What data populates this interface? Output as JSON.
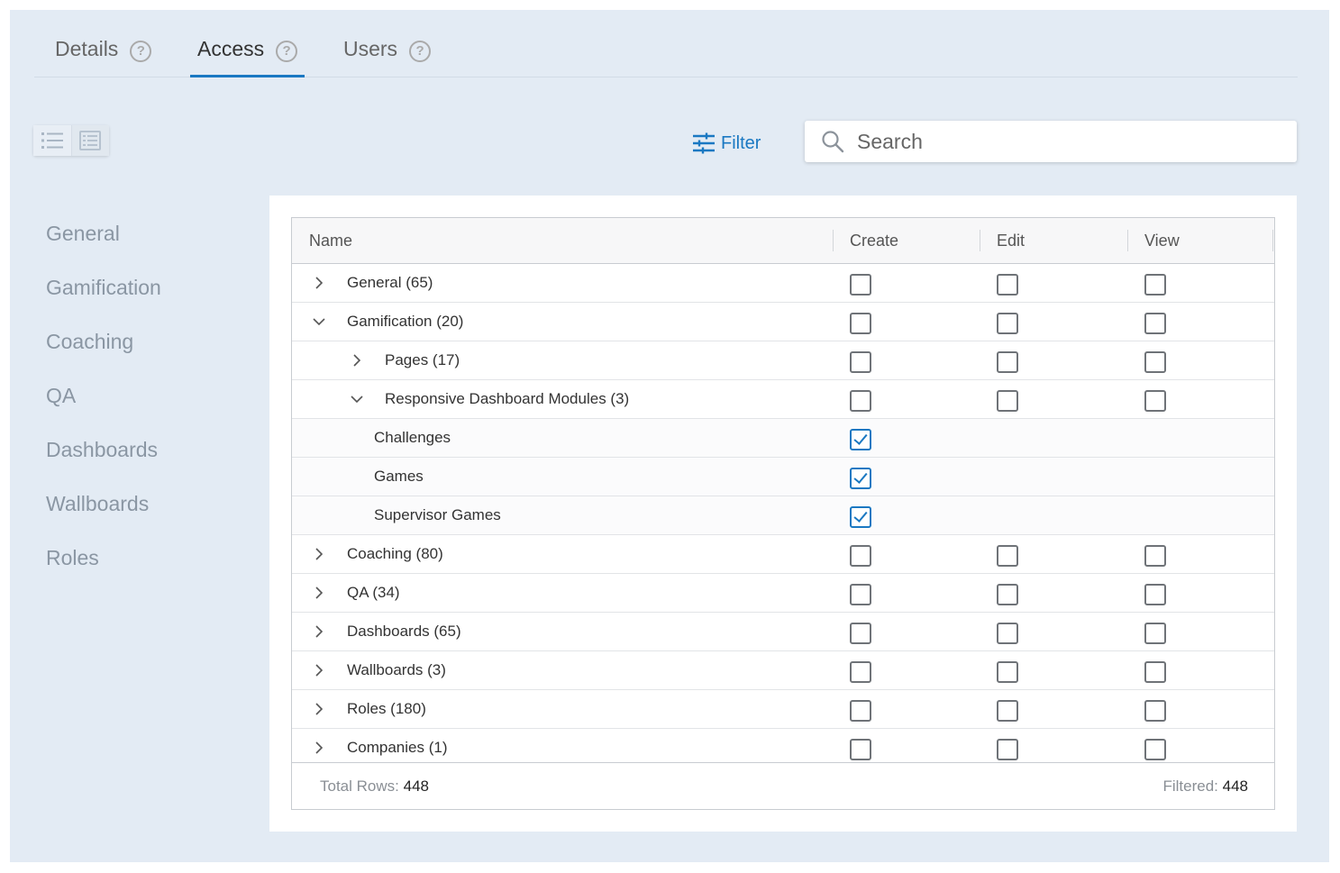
{
  "tabs": [
    {
      "label": "Details",
      "help": "?"
    },
    {
      "label": "Access",
      "help": "?"
    },
    {
      "label": "Users",
      "help": "?"
    }
  ],
  "toolbar": {
    "filter_label": "Filter",
    "search_placeholder": "Search"
  },
  "sidenav": {
    "items": [
      "General",
      "Gamification",
      "Coaching",
      "QA",
      "Dashboards",
      "Wallboards",
      "Roles"
    ]
  },
  "table": {
    "columns": {
      "name": "Name",
      "create": "Create",
      "edit": "Edit",
      "view": "View"
    },
    "rows": [
      {
        "label": "General (65)",
        "level": 0,
        "caret": "right",
        "create": false,
        "edit": false,
        "view": false
      },
      {
        "label": "Gamification (20)",
        "level": 0,
        "caret": "down",
        "create": false,
        "edit": false,
        "view": false
      },
      {
        "label": "Pages (17)",
        "level": 1,
        "caret": "right",
        "create": false,
        "edit": false,
        "view": false
      },
      {
        "label": "Responsive Dashboard Modules (3)",
        "level": 1,
        "caret": "down",
        "create": false,
        "edit": false,
        "view": false
      },
      {
        "label": "Challenges",
        "level": 2,
        "caret": "none",
        "create": true
      },
      {
        "label": "Games",
        "level": 2,
        "caret": "none",
        "create": true
      },
      {
        "label": "Supervisor Games",
        "level": 2,
        "caret": "none",
        "create": true
      },
      {
        "label": "Coaching (80)",
        "level": 0,
        "caret": "right",
        "create": false,
        "edit": false,
        "view": false
      },
      {
        "label": "QA (34)",
        "level": 0,
        "caret": "right",
        "create": false,
        "edit": false,
        "view": false
      },
      {
        "label": "Dashboards (65)",
        "level": 0,
        "caret": "right",
        "create": false,
        "edit": false,
        "view": false
      },
      {
        "label": "Wallboards (3)",
        "level": 0,
        "caret": "right",
        "create": false,
        "edit": false,
        "view": false
      },
      {
        "label": "Roles (180)",
        "level": 0,
        "caret": "right",
        "create": false,
        "edit": false,
        "view": false
      },
      {
        "label": "Companies (1)",
        "level": 0,
        "caret": "right",
        "create": false,
        "edit": false,
        "view": false
      }
    ],
    "footer": {
      "total_label": "Total Rows:",
      "total_value": "448",
      "filtered_label": "Filtered:",
      "filtered_value": "448"
    }
  },
  "colors": {
    "accent": "#1a78c2",
    "background": "#e3ebf4"
  },
  "icons": {
    "help": "help-circle-icon",
    "filter": "sliders-icon",
    "search": "search-icon",
    "list_view": "list-icon",
    "detail_view": "detail-list-icon",
    "expand": "chevron-right-icon",
    "collapse": "chevron-down-icon"
  }
}
